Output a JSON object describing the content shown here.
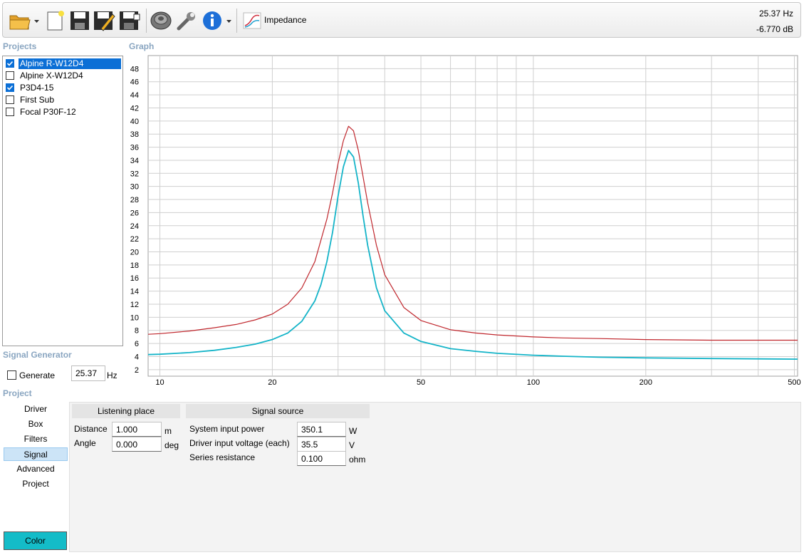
{
  "toolbar": {
    "mode_label": "Impedance",
    "frequency_readout": "25.37 Hz",
    "level_readout": "-6.770 dB"
  },
  "sections": {
    "projects": "Projects",
    "graph": "Graph",
    "signal_generator": "Signal Generator",
    "project": "Project"
  },
  "projects": [
    {
      "name": "Alpine R-W12D4",
      "checked": true,
      "selected": true
    },
    {
      "name": "Alpine X-W12D4",
      "checked": false,
      "selected": false
    },
    {
      "name": "P3D4-15",
      "checked": true,
      "selected": false
    },
    {
      "name": "First Sub",
      "checked": false,
      "selected": false
    },
    {
      "name": "Focal P30F-12",
      "checked": false,
      "selected": false
    }
  ],
  "signal_generator": {
    "generate_label": "Generate",
    "frequency_value": "25.37",
    "unit": "Hz"
  },
  "nav": [
    "Driver",
    "Box",
    "Filters",
    "Signal",
    "Advanced",
    "Project"
  ],
  "nav_active": "Signal",
  "listening_place": {
    "title": "Listening place",
    "distance_label": "Distance",
    "distance_value": "1.000",
    "distance_unit": "m",
    "angle_label": "Angle",
    "angle_value": "0.000",
    "angle_unit": "deg"
  },
  "signal_source": {
    "title": "Signal source",
    "power_label": "System input power",
    "power_value": "350.1",
    "power_unit": "W",
    "voltage_label": "Driver input voltage (each)",
    "voltage_value": "35.5",
    "voltage_unit": "V",
    "resistance_label": "Series resistance",
    "resistance_value": "0.100",
    "resistance_unit": "ohm"
  },
  "color_button": "Color",
  "colors": {
    "series_red": "#c0272d",
    "series_cyan": "#14b4c8",
    "selection": "#0b6fd6",
    "section_title": "#8aa6c1"
  },
  "chart_data": {
    "type": "line",
    "x_scale": "log",
    "xlim": [
      9.3,
      510
    ],
    "ylim": [
      1,
      50
    ],
    "x_ticks": [
      10,
      20,
      50,
      100,
      200,
      500
    ],
    "y_ticks": [
      2,
      4,
      6,
      8,
      10,
      12,
      14,
      16,
      18,
      20,
      22,
      24,
      26,
      28,
      30,
      32,
      34,
      36,
      38,
      40,
      42,
      44,
      46,
      48
    ],
    "grid": true,
    "series": [
      {
        "color": "#c0272d",
        "x": [
          9.3,
          10,
          12,
          14,
          16,
          18,
          20,
          22,
          24,
          26,
          28,
          29,
          30,
          31,
          32,
          33,
          34,
          35,
          36,
          38,
          40,
          45,
          50,
          60,
          70,
          80,
          100,
          120,
          150,
          200,
          300,
          400,
          510
        ],
        "y": [
          7.4,
          7.5,
          7.9,
          8.4,
          8.9,
          9.6,
          10.5,
          12.0,
          14.5,
          18.5,
          25.0,
          29.0,
          33.5,
          37.0,
          39.2,
          38.5,
          35.5,
          31.5,
          27.5,
          21.0,
          16.5,
          11.5,
          9.5,
          8.1,
          7.6,
          7.3,
          7.0,
          6.85,
          6.75,
          6.6,
          6.5,
          6.5,
          6.5
        ]
      },
      {
        "color": "#14b4c8",
        "x": [
          9.3,
          10,
          12,
          14,
          16,
          18,
          20,
          22,
          24,
          26,
          27,
          28,
          29,
          30,
          31,
          32,
          33,
          34,
          35,
          36,
          38,
          40,
          45,
          50,
          60,
          70,
          80,
          100,
          120,
          150,
          200,
          300,
          400,
          510
        ],
        "y": [
          4.3,
          4.35,
          4.6,
          4.95,
          5.4,
          5.9,
          6.6,
          7.6,
          9.4,
          12.5,
          15.0,
          18.5,
          23.0,
          28.5,
          33.0,
          35.5,
          34.5,
          30.5,
          25.5,
          21.0,
          14.5,
          11.0,
          7.6,
          6.3,
          5.2,
          4.8,
          4.5,
          4.2,
          4.05,
          3.9,
          3.8,
          3.7,
          3.65,
          3.6
        ]
      }
    ]
  }
}
